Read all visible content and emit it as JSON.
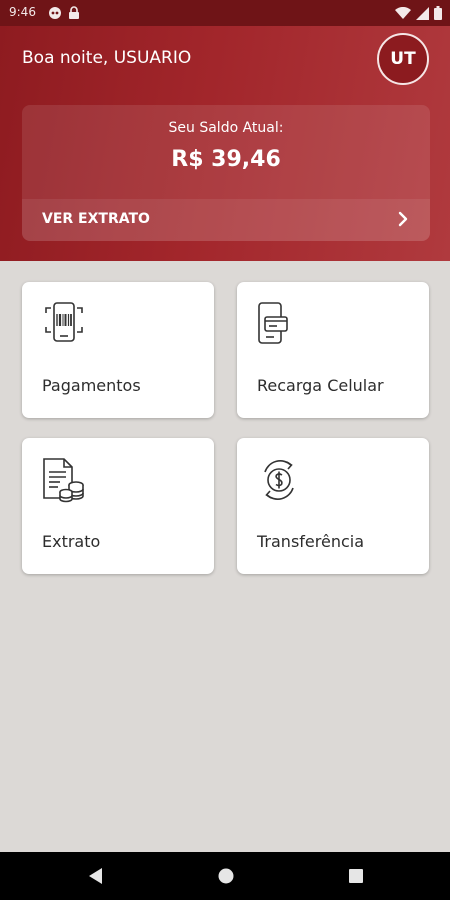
{
  "status_bar": {
    "time": "9:46",
    "left_icons": [
      "incognito-icon",
      "lock-icon"
    ],
    "right_icons": [
      "wifi-icon",
      "signal-icon",
      "battery-icon"
    ]
  },
  "header": {
    "greeting": "Boa noite, USUARIO",
    "avatar_initials": "UT",
    "accent_color": "#a2262b"
  },
  "balance": {
    "label": "Seu Saldo Atual:",
    "value": "R$ 39,46",
    "ver_extrato_label": "VER EXTRATO"
  },
  "tiles": [
    {
      "label": "Pagamentos",
      "icon": "barcode-phone-icon"
    },
    {
      "label": "Recarga Celular",
      "icon": "phone-card-icon"
    },
    {
      "label": "Extrato",
      "icon": "document-coins-icon"
    },
    {
      "label": "Transferência",
      "icon": "money-transfer-icon"
    }
  ],
  "nav_bar": {
    "icons": [
      "back-icon",
      "home-icon",
      "recents-icon"
    ]
  }
}
